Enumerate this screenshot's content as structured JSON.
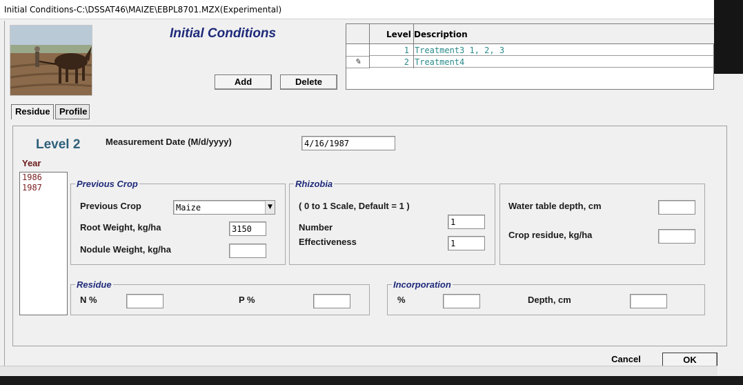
{
  "window": {
    "title": "Initial Conditions-C:\\DSSAT46\\MAIZE\\EBPL8701.MZX(Experimental)"
  },
  "header": {
    "title": "Initial Conditions"
  },
  "level_table": {
    "columns": [
      "Level",
      "Description"
    ],
    "rows": [
      {
        "level": "1",
        "description": "Treatment3 1, 2, 3"
      },
      {
        "level": "2",
        "description": "Treatment4"
      }
    ]
  },
  "toolbar": {
    "add_label": "Add",
    "delete_label": "Delete"
  },
  "tabs": [
    {
      "label": "Residue"
    },
    {
      "label": "Profile"
    }
  ],
  "panel": {
    "level_heading": "Level 2",
    "measurement_date_label": "Measurement Date (M/d/yyyy)",
    "measurement_date_value": "4/16/1987",
    "year_label": "Year",
    "years": [
      "1986",
      "1987"
    ]
  },
  "previous_crop": {
    "title": "Previous Crop",
    "crop_label": "Previous Crop",
    "crop_value": "Maize",
    "root_weight_label": "Root Weight, kg/ha",
    "root_weight_value": "3150",
    "nodule_weight_label": "Nodule Weight, kg/ha",
    "nodule_weight_value": ""
  },
  "rhizobia": {
    "title": "Rhizobia",
    "scale_note": "( 0 to 1 Scale, Default = 1 )",
    "number_label": "Number",
    "number_value": "1",
    "effectiveness_label": "Effectiveness",
    "effectiveness_value": "1"
  },
  "water": {
    "water_table_label": "Water table depth, cm",
    "water_table_value": "",
    "crop_residue_label": "Crop residue, kg/ha",
    "crop_residue_value": ""
  },
  "residue": {
    "title": "Residue",
    "n_label": "N %",
    "n_value": "",
    "p_label": "P %",
    "p_value": ""
  },
  "incorporation": {
    "title": "Incorporation",
    "pct_label": "%",
    "pct_value": "",
    "depth_label": "Depth, cm",
    "depth_value": ""
  },
  "footer": {
    "cancel_label": "Cancel",
    "ok_label": "OK"
  },
  "colors": {
    "accent_title": "#1e2a7a",
    "grid_text": "#2a8a8a",
    "year_text": "#7a2020"
  }
}
